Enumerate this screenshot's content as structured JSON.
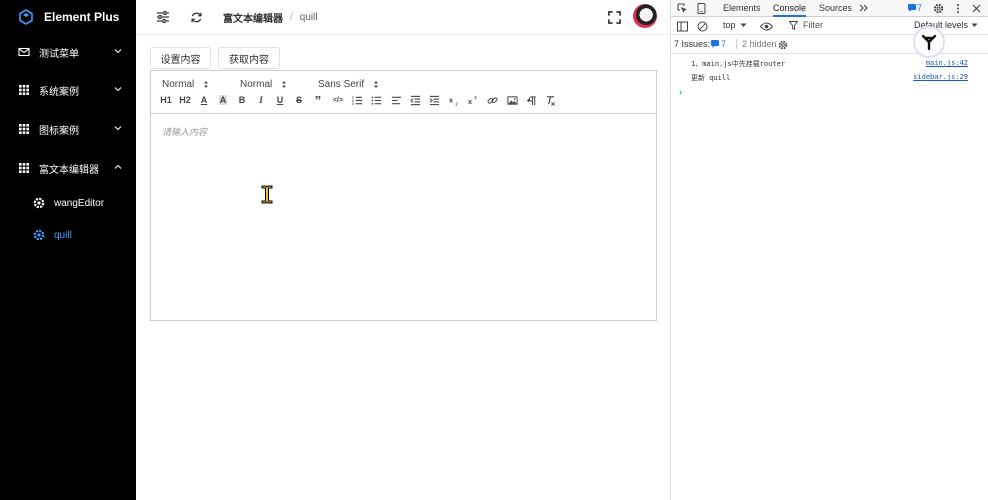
{
  "app": {
    "brand": "Element Plus"
  },
  "sidebar": {
    "items": [
      {
        "label": "测试菜单",
        "icon": "message-icon"
      },
      {
        "label": "系统案例",
        "icon": "grid-icon"
      },
      {
        "label": "图标案例",
        "icon": "grid-icon"
      },
      {
        "label": "富文本编辑器",
        "icon": "grid-icon"
      }
    ],
    "sub_items": [
      {
        "label": "wangEditor",
        "icon": "settings-icon"
      },
      {
        "label": "quill",
        "icon": "settings-icon"
      }
    ]
  },
  "header": {
    "breadcrumb": [
      "富文本编辑器",
      "quill"
    ],
    "breadcrumb_sep": "/"
  },
  "actions": {
    "set_content": "设置内容",
    "get_content": "获取内容"
  },
  "editor": {
    "pickers": [
      "Normal",
      "Normal",
      "Sans Serif"
    ],
    "toolbar_buttons": [
      "H1",
      "H2",
      "A",
      "A",
      "B",
      "I",
      "U",
      "S",
      "”",
      "</>",
      "ordered-list",
      "bullet-list",
      "align",
      "outdent",
      "indent",
      "subscript",
      "superscript",
      "link",
      "image",
      "direction",
      "clean"
    ],
    "placeholder": "请输入内容"
  },
  "devtools": {
    "tabs": [
      "Elements",
      "Console",
      "Sources"
    ],
    "active_tab": "Console",
    "badge_count": "7",
    "context": "top",
    "filter_placeholder": "Filter",
    "levels": "Default levels",
    "issues_label": "7 Issues:",
    "issues_count": "7",
    "hidden": "2 hidden",
    "console": [
      {
        "message": "1、main.js中先挂载router",
        "source": "main.js:42"
      },
      {
        "message": "更新 quill",
        "source": "sidebar.js:29"
      }
    ],
    "prompt": "›"
  },
  "colors": {
    "sidebar_bg": "#000000",
    "accent": "#409eff",
    "devtools_link": "#1a58c0"
  }
}
